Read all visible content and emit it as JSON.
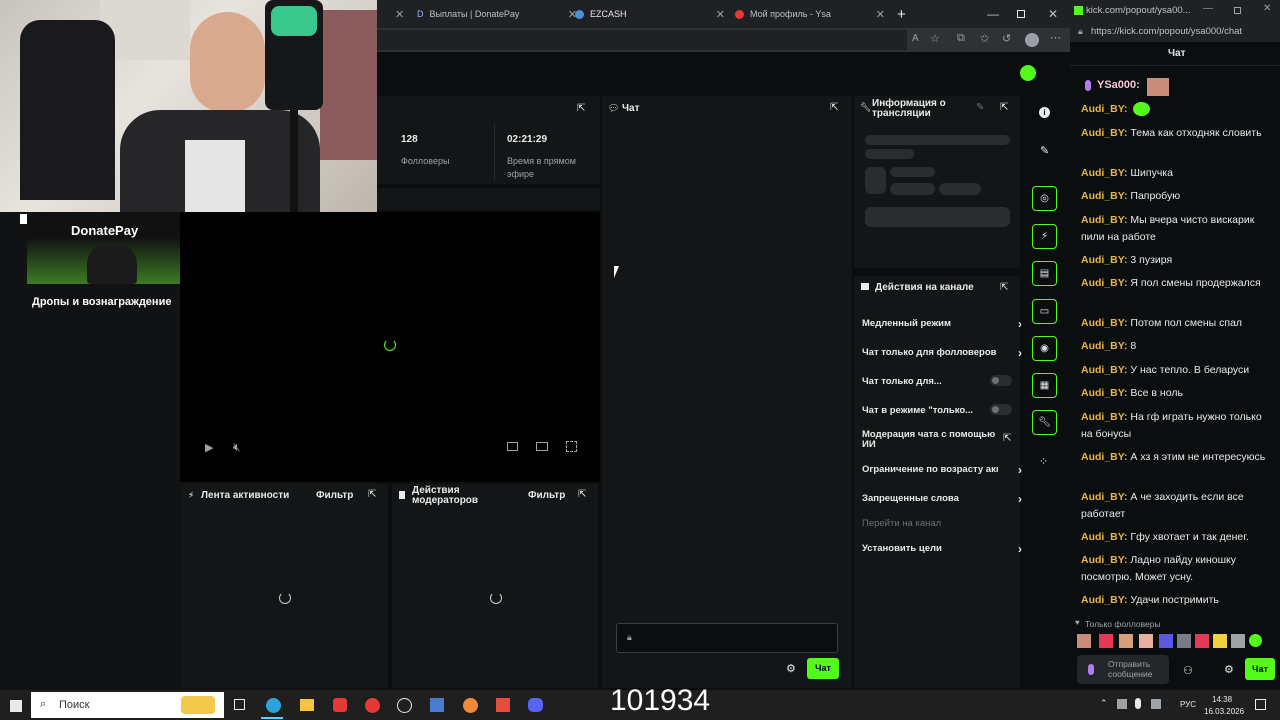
{
  "webcam": {
    "logo_text": "DonatePay",
    "overlay_text": "Дропы и вознаграждение"
  },
  "browser": {
    "tabs": [
      {
        "label": "Выплаты | DonatePay"
      },
      {
        "label": "EZCASH"
      },
      {
        "label": "Мой профиль - Ysa"
      }
    ]
  },
  "stats": {
    "followers_value": "128",
    "followers_label": "Фолловеры",
    "live_value": "02:21:29",
    "live_label": "Время в прямом эфире"
  },
  "panels": {
    "chat_title": "Чат",
    "stream_info_title": "Информация о трансляции",
    "channel_actions_title": "Действия на канале",
    "activity_title": "Лента активности",
    "activity_filter": "Фильтр",
    "mod_actions_title": "Действия модераторов",
    "mod_filter": "Фильтр"
  },
  "channel_actions": [
    {
      "label": "Медленный режим",
      "control": "chevron"
    },
    {
      "label": "Чат только для фолловеров",
      "control": "chevron"
    },
    {
      "label": "Чат только для...",
      "control": "toggle"
    },
    {
      "label": "Чат в режиме \"только...",
      "control": "toggle"
    },
    {
      "label": "Модерация чата с помощью ИИ",
      "control": "external"
    },
    {
      "label": "Ограничение по возрасту акк",
      "control": "chevron"
    },
    {
      "label": "Запрещенные слова",
      "control": "chevron"
    },
    {
      "label": "Перейти на канал",
      "control": "none"
    },
    {
      "label": "Установить цели",
      "control": "chevron"
    }
  ],
  "center_chat": {
    "send_label": "Чат"
  },
  "popout": {
    "url": "kick.com/popout/ysa00...",
    "url_full": "https://kick.com/popout/ysa000/chat",
    "header": "Чат",
    "streamer_name": "YSa000:",
    "messages": [
      {
        "user": "Audi_BY:",
        "text": ""
      },
      {
        "user": "Audi_BY:",
        "text": "Тема как отходняк словить"
      },
      {
        "user": "Audi_BY:",
        "text": "Шипучка"
      },
      {
        "user": "Audi_BY:",
        "text": "Папробую"
      },
      {
        "user": "Audi_BY:",
        "text": "Мы вчера чисто вискарик пили на работе"
      },
      {
        "user": "Audi_BY:",
        "text": "3 пузиря"
      },
      {
        "user": "Audi_BY:",
        "text": "Я пол смены продержался"
      },
      {
        "user": "Audi_BY:",
        "text": "Потом пол смены спал"
      },
      {
        "user": "Audi_BY:",
        "text": "8"
      },
      {
        "user": "Audi_BY:",
        "text": "У нас тепло. В беларуси"
      },
      {
        "user": "Audi_BY:",
        "text": "Все в ноль"
      },
      {
        "user": "Audi_BY:",
        "text": "На гф играть нужно только на бонусы"
      },
      {
        "user": "Audi_BY:",
        "text": "А хз я этим не интересуюсь"
      },
      {
        "user": "Audi_BY:",
        "text": "А че заходить если все работает"
      },
      {
        "user": "Audi_BY:",
        "text": "Гфу хвотает и так денег."
      },
      {
        "user": "Audi_BY:",
        "text": "Ладно пайду киношку посмотрю. Может усну."
      },
      {
        "user": "Audi_BY:",
        "text": "Удачи постримить"
      }
    ],
    "followers_only": "Только фолловеры",
    "input_placeholder": "Отправить сообщение",
    "send_label": "Чат"
  },
  "overlay_counter": "101934",
  "taskbar": {
    "search_placeholder": "Поиск",
    "lang": "РУС",
    "time": "14:38",
    "date": "16.03.2026"
  },
  "colors": {
    "accent": "#53fc18",
    "username": "#e8b54a",
    "panel": "#131516",
    "background": "#0b0e0f"
  }
}
